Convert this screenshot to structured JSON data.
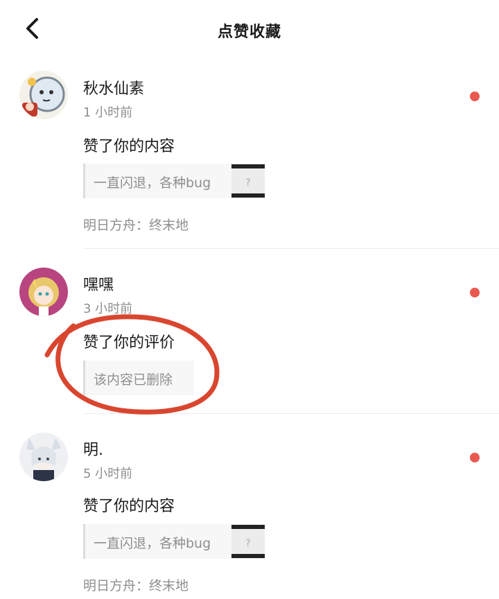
{
  "header": {
    "back_icon": "chevron-left-icon",
    "title": "点赞收藏"
  },
  "notifications": [
    {
      "username": "秋水仙素",
      "time": "1 小时前",
      "action": "赞了你的内容",
      "quote": "一直闪退，各种bug",
      "has_thumbnail": true,
      "source": "明日方舟：终末地",
      "unread": true
    },
    {
      "username": "嘿嘿",
      "time": "3 小时前",
      "action": "赞了你的评价",
      "quote": "该内容已删除",
      "has_thumbnail": false,
      "unread": true
    },
    {
      "username": "明.",
      "time": "5 小时前",
      "action": "赞了你的内容",
      "quote": "一直闪退，各种bug",
      "has_thumbnail": true,
      "source": "明日方舟：终末地",
      "unread": true
    }
  ],
  "colors": {
    "unread_dot": "#e9594f",
    "annotation_stroke": "#d9462f"
  }
}
